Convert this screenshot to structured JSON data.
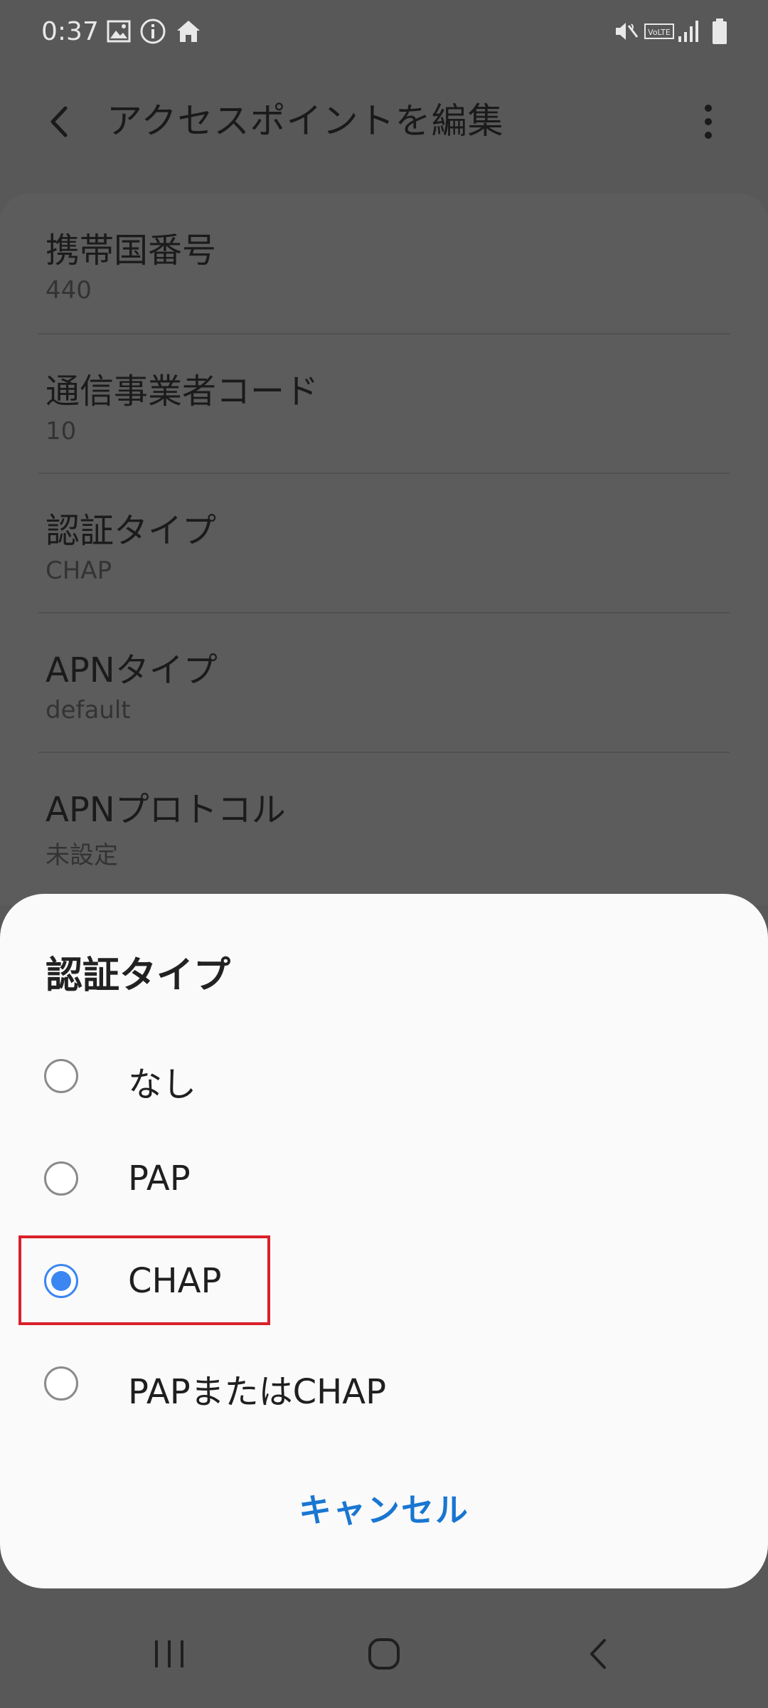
{
  "status_bar": {
    "time": "0:37",
    "left_icons": [
      "image-icon",
      "info-icon",
      "home-icon"
    ],
    "right_icons": [
      "mute-vibrate-icon",
      "volte-icon",
      "signal-icon",
      "battery-icon"
    ],
    "volte_text": "VoLTE"
  },
  "app_bar": {
    "title": "アクセスポイントを編集",
    "back_icon": "back-arrow-icon",
    "more_icon": "more-vert-icon"
  },
  "settings_list": [
    {
      "label": "携帯国番号",
      "value": "440"
    },
    {
      "label": "通信事業者コード",
      "value": "10"
    },
    {
      "label": "認証タイプ",
      "value": "CHAP"
    },
    {
      "label": "APNタイプ",
      "value": "default"
    },
    {
      "label": "APNプロトコル",
      "value": "未設定"
    }
  ],
  "dialog": {
    "title": "認証タイプ",
    "options": [
      {
        "label": "なし",
        "selected": false
      },
      {
        "label": "PAP",
        "selected": false
      },
      {
        "label": "CHAP",
        "selected": true
      },
      {
        "label": "PAPまたはCHAP",
        "selected": false
      }
    ],
    "cancel_label": "キャンセル"
  },
  "nav_bar": {
    "buttons": [
      "recent-apps-icon",
      "home-button-icon",
      "back-icon"
    ]
  },
  "colors": {
    "accent": "#3b86f0",
    "cancel_text": "#1976d2",
    "highlight": "#d9202a",
    "scrim": "#585858",
    "dialog_bg": "#fafafa"
  }
}
